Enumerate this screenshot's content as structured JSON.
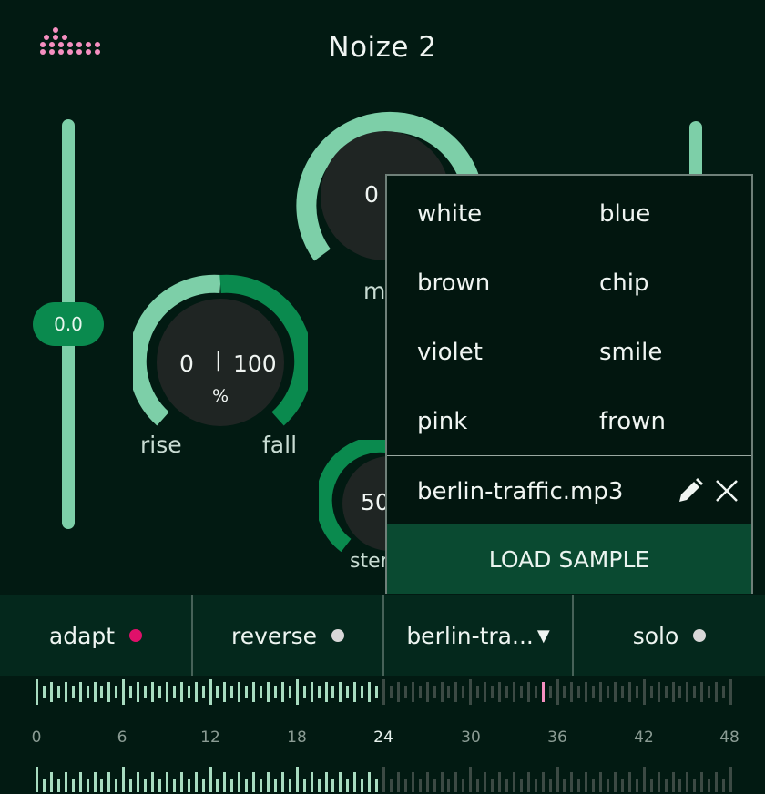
{
  "app": {
    "title": "Noize 2",
    "logo_icon": "dots-logo-icon"
  },
  "left_slider": {
    "value": "0.0"
  },
  "knobs": {
    "main": {
      "value": "0",
      "label": "m"
    },
    "rise_fall": {
      "left_value": "0",
      "separator": "|",
      "right_value": "100",
      "unit": "%",
      "rise_label": "rise",
      "fall_label": "fall"
    },
    "stereo": {
      "value": "50",
      "label": "ster"
    }
  },
  "toolbar": {
    "adapt": {
      "label": "adapt",
      "dot_color": "#e0106a"
    },
    "reverse": {
      "label": "reverse",
      "dot_color": "#d8d8d8"
    },
    "sample_select": {
      "label": "berlin-tra...",
      "arrow": "▼"
    },
    "solo": {
      "label": "solo",
      "dot_color": "#d8d8d8"
    }
  },
  "ruler": {
    "labels": [
      "0",
      "6",
      "12",
      "18",
      "24",
      "30",
      "36",
      "42",
      "48"
    ],
    "highlight_label": "24"
  },
  "popup": {
    "options_left": [
      "white",
      "brown",
      "violet",
      "pink"
    ],
    "options_right": [
      "blue",
      "chip",
      "smile",
      "frown"
    ],
    "file_name": "berlin-traffic.mp3",
    "edit_icon": "pencil-icon",
    "close_icon": "close-icon",
    "load_label": "LOAD SAMPLE"
  },
  "colors": {
    "background": "#021a12",
    "accent_light": "#7dcfa8",
    "accent_dark": "#0a8a4e",
    "logo": "#f58fc0",
    "marker": "#f58fc0"
  }
}
